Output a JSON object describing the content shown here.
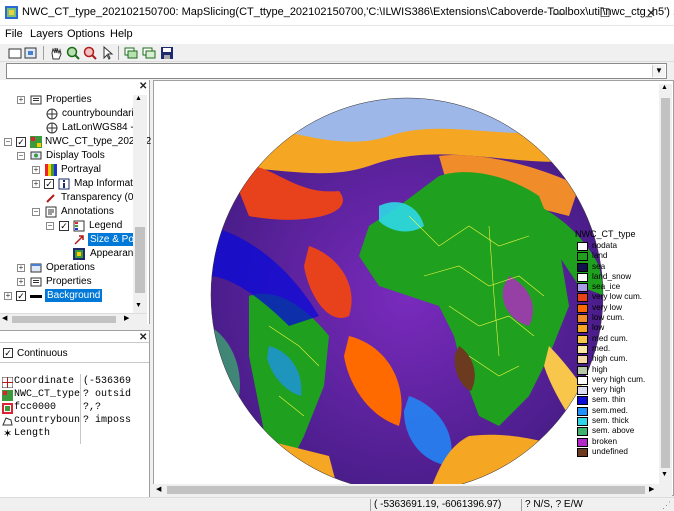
{
  "window": {
    "title": "NWC_CT_type_202102150700: MapSlicing(CT_ttype_202102150700,'C:\\ILWIS386\\Extensions\\Caboverde-Toolbox\\util\\nwc_ctg_h5') ...",
    "minimize": "—",
    "maximize": "☐",
    "close": "✕"
  },
  "menu": [
    "File",
    "Layers",
    "Options",
    "Help"
  ],
  "toolbar": {
    "icons": [
      "new-map-icon",
      "open-icon",
      "pan-hand-icon",
      "zoom-in-icon",
      "zoom-out-icon",
      "select-pointer-icon",
      "layers-add-icon",
      "layers-remove-icon",
      "save-icon"
    ]
  },
  "command": {
    "value": ""
  },
  "tree": {
    "rows": [
      {
        "label": "Properties"
      },
      {
        "label": "countryboundarie"
      },
      {
        "label": "LatLonWGS84 - C"
      },
      {
        "label": "NWC_CT_type_202102"
      },
      {
        "label": "Display Tools"
      },
      {
        "label": "Portrayal"
      },
      {
        "label": "Map Informati"
      },
      {
        "label": "Transparency (0)"
      },
      {
        "label": "Annotations"
      },
      {
        "label": "Legend"
      },
      {
        "label": "Size & Pos"
      },
      {
        "label": "Appearanc"
      },
      {
        "label": "Operations"
      },
      {
        "label": "Properties"
      },
      {
        "label": "Background"
      }
    ]
  },
  "pixel_info": {
    "continuous_label": "Continuous",
    "rows": [
      {
        "name": "Coordinate",
        "value": "(-536369"
      },
      {
        "name": "NWC_CT_type",
        "value": "? outsid"
      },
      {
        "name": "fcc0000",
        "value": "?,?"
      },
      {
        "name": "countryboun",
        "value": "? imposs"
      },
      {
        "name": "Length",
        "value": ""
      }
    ]
  },
  "legend": {
    "title": "NWC_CT_type",
    "items": [
      {
        "label": "nodata",
        "color": "#ffffff"
      },
      {
        "label": "land",
        "color": "#1fa01f"
      },
      {
        "label": "sea",
        "color": "#12124d"
      },
      {
        "label": "land_snow",
        "color": "#ffffff"
      },
      {
        "label": "sea_ice",
        "color": "#a89ce6"
      },
      {
        "label": "very low cum.",
        "color": "#e8421c"
      },
      {
        "label": "very low",
        "color": "#ff6a00"
      },
      {
        "label": "low cum.",
        "color": "#f08c2a"
      },
      {
        "label": "low",
        "color": "#f5a623"
      },
      {
        "label": "med cum.",
        "color": "#f7c64a"
      },
      {
        "label": "med.",
        "color": "#fbe8a6"
      },
      {
        "label": "high cum.",
        "color": "#f4d8a8"
      },
      {
        "label": "high",
        "color": "#b6c8a8"
      },
      {
        "label": "very high cum.",
        "color": "#ffffff"
      },
      {
        "label": "very high",
        "color": "#dcdcf5"
      },
      {
        "label": "sem. thin",
        "color": "#0a0ad9"
      },
      {
        "label": "sem.med.",
        "color": "#1e90ff"
      },
      {
        "label": "sem. thick",
        "color": "#2fd7e6"
      },
      {
        "label": "sem. above",
        "color": "#3cb46e"
      },
      {
        "label": "broken",
        "color": "#b428c8"
      },
      {
        "label": "undefined",
        "color": "#6b3a1f"
      }
    ]
  },
  "status": {
    "coordinate": "( -5363691.19, -6061396.97)",
    "latlon": "? N/S, ? E/W"
  }
}
